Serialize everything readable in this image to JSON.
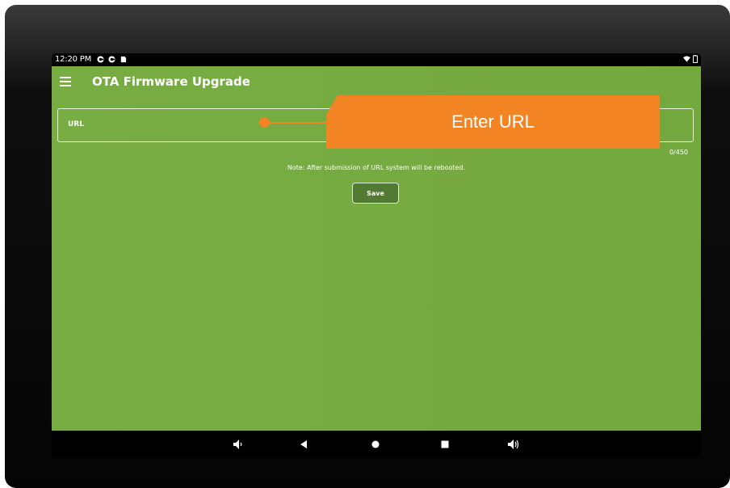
{
  "status_bar": {
    "time": "12:20 PM",
    "icons": [
      "g-icon",
      "g-icon",
      "sim-icon"
    ],
    "right_icons": [
      "wifi-icon",
      "battery-icon"
    ]
  },
  "app": {
    "title": "OTA Firmware Upgrade",
    "url_field": {
      "label": "URL",
      "counter": "0/450"
    },
    "note": "Note: After submission of URL system will be rebooted.",
    "save_label": "Save"
  },
  "callout": {
    "text": "Enter URL",
    "color": "#f28423"
  },
  "nav_bar": {
    "icons": [
      "volume-down-icon",
      "back-icon",
      "home-icon",
      "recents-icon",
      "volume-up-icon"
    ]
  },
  "colors": {
    "app_bg": "#76ab42",
    "button_bg": "#527a33",
    "accent": "#f28423"
  }
}
